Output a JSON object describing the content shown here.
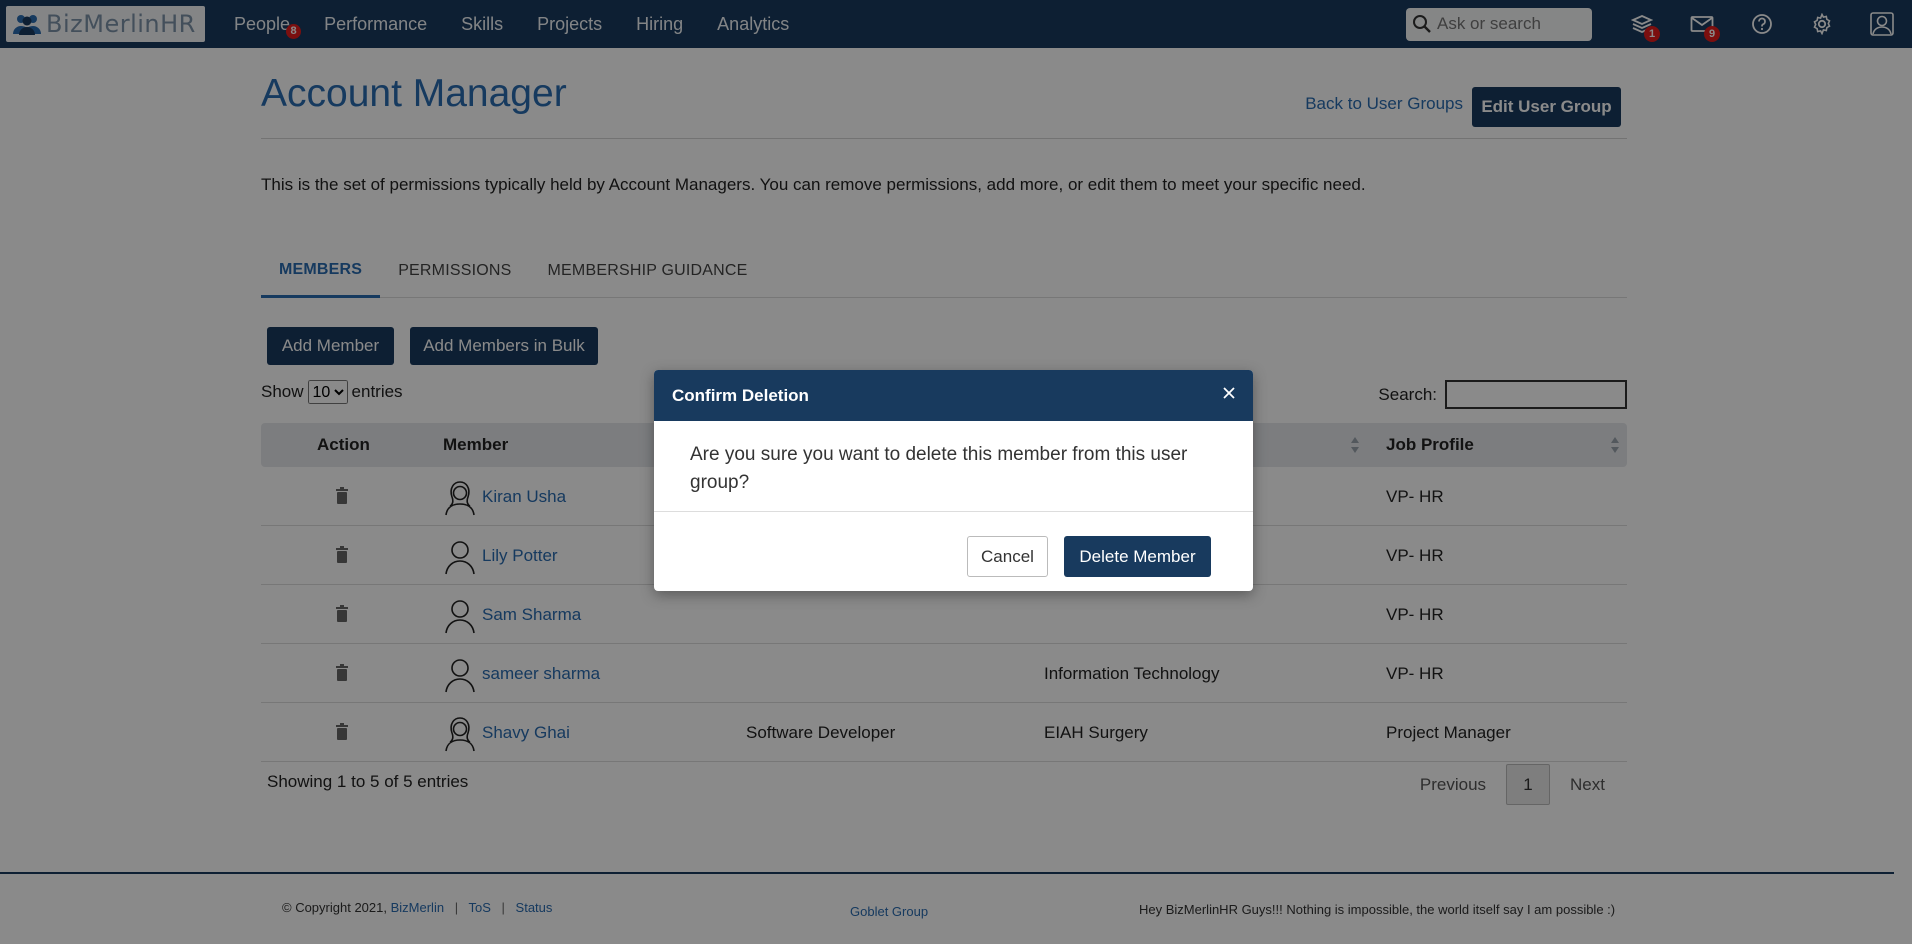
{
  "navbar": {
    "logo_text": "BizMerlinHR",
    "menu": [
      {
        "label": "People",
        "badge": "8"
      },
      {
        "label": "Performance"
      },
      {
        "label": "Skills"
      },
      {
        "label": "Projects"
      },
      {
        "label": "Hiring"
      },
      {
        "label": "Analytics"
      }
    ],
    "search_placeholder": "Ask or search",
    "notifications_badge": "1",
    "messages_badge": "9"
  },
  "page": {
    "title": "Account Manager",
    "back_link": "Back to User Groups",
    "edit_button": "Edit User Group",
    "description": "This is the set of permissions typically held by Account Managers. You can remove permissions, add more, or edit them to meet your specific need."
  },
  "tabs": [
    {
      "label": "MEMBERS",
      "active": true
    },
    {
      "label": "PERMISSIONS"
    },
    {
      "label": "MEMBERSHIP GUIDANCE"
    }
  ],
  "actions": {
    "add_member": "Add Member",
    "add_bulk": "Add Members in Bulk"
  },
  "table": {
    "show_label": "Show",
    "entries_label": "entries",
    "page_size": "10",
    "search_label": "Search:",
    "headers": [
      "Action",
      "Member",
      "",
      "",
      "Job Profile"
    ],
    "rows": [
      {
        "name": "Kiran Usha",
        "col3": "",
        "col4": "",
        "job": "VP- HR",
        "avatar": "female"
      },
      {
        "name": "Lily Potter",
        "col3": "",
        "col4": "",
        "job": "VP- HR",
        "avatar": "male"
      },
      {
        "name": "Sam Sharma",
        "col3": "",
        "col4": "",
        "job": "VP- HR",
        "avatar": "male"
      },
      {
        "name": "sameer sharma",
        "col3": "",
        "col4": "Information Technology",
        "job": "VP- HR",
        "avatar": "male"
      },
      {
        "name": "Shavy Ghai",
        "col3": "Software Developer",
        "col4": "EIAH Surgery",
        "job": "Project Manager",
        "avatar": "female"
      }
    ],
    "showing": "Showing 1 to 5 of 5 entries",
    "prev": "Previous",
    "current_page": "1",
    "next": "Next"
  },
  "footer": {
    "copyright": "© Copyright 2021,",
    "company_link": "BizMerlin",
    "tos": "ToS",
    "status": "Status",
    "group": "Goblet Group",
    "message": "Hey BizMerlinHR Guys!!! Nothing is impossible, the world itself say I am possible :)"
  },
  "modal": {
    "title": "Confirm Deletion",
    "body": "Are you sure you want to delete this member from this user group?",
    "cancel": "Cancel",
    "confirm": "Delete Member"
  },
  "colors": {
    "navbar": "#183a5e",
    "link": "#2a6bb0",
    "badge": "#e31d1d"
  }
}
